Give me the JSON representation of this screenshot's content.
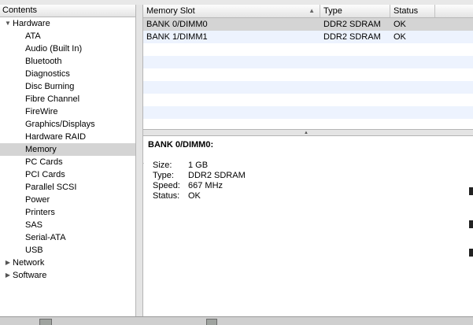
{
  "sidebar": {
    "header": "Contents",
    "items": [
      {
        "label": "Hardware",
        "level": 0,
        "expanded": true
      },
      {
        "label": "ATA",
        "level": 1
      },
      {
        "label": "Audio (Built In)",
        "level": 1
      },
      {
        "label": "Bluetooth",
        "level": 1
      },
      {
        "label": "Diagnostics",
        "level": 1
      },
      {
        "label": "Disc Burning",
        "level": 1
      },
      {
        "label": "Fibre Channel",
        "level": 1
      },
      {
        "label": "FireWire",
        "level": 1
      },
      {
        "label": "Graphics/Displays",
        "level": 1
      },
      {
        "label": "Hardware RAID",
        "level": 1
      },
      {
        "label": "Memory",
        "level": 1,
        "selected": true
      },
      {
        "label": "PC Cards",
        "level": 1
      },
      {
        "label": "PCI Cards",
        "level": 1
      },
      {
        "label": "Parallel SCSI",
        "level": 1
      },
      {
        "label": "Power",
        "level": 1
      },
      {
        "label": "Printers",
        "level": 1
      },
      {
        "label": "SAS",
        "level": 1
      },
      {
        "label": "Serial-ATA",
        "level": 1
      },
      {
        "label": "USB",
        "level": 1
      },
      {
        "label": "Network",
        "level": 0,
        "expanded": false
      },
      {
        "label": "Software",
        "level": 0,
        "expanded": false
      }
    ]
  },
  "table": {
    "columns": [
      "Memory Slot",
      "Type",
      "Status"
    ],
    "rows": [
      {
        "slot": "BANK 0/DIMM0",
        "type": "DDR2 SDRAM",
        "status": "OK",
        "selected": true
      },
      {
        "slot": "BANK 1/DIMM1",
        "type": "DDR2 SDRAM",
        "status": "OK"
      }
    ]
  },
  "details": {
    "title": "BANK 0/DIMM0:",
    "fields": [
      {
        "key": "Size:",
        "value": "1 GB"
      },
      {
        "key": "Type:",
        "value": "DDR2 SDRAM"
      },
      {
        "key": "Speed:",
        "value": "667 MHz"
      },
      {
        "key": "Status:",
        "value": "OK"
      }
    ]
  },
  "colors": {
    "selection": "#d4d4d4",
    "alt_row": "#edf3fe"
  }
}
